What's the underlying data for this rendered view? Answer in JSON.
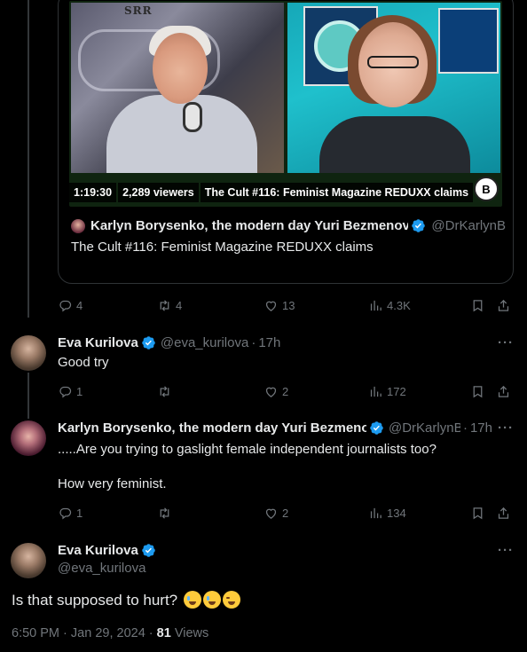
{
  "quote": {
    "video": {
      "duration": "1:19:30",
      "viewers": "2,289 viewers",
      "title": "The Cult #116: Feminist Magazine REDUXX claims",
      "sign_text": "SRR",
      "logo": "B"
    },
    "author_name": "Karlyn Borysenko, the modern day Yuri Bezmenov",
    "author_handle": "@DrKarlynB",
    "text": "The Cult #116: Feminist Magazine REDUXX claims"
  },
  "colors": {
    "background": "#000000",
    "text": "#e7e9ea",
    "muted": "#71767b",
    "verified": "#1d9bf0",
    "border": "#2f3336"
  },
  "first_actions": {
    "replies": "4",
    "reposts": "4",
    "likes": "13",
    "views": "4.3K"
  },
  "reply1": {
    "name": "Eva Kurilova",
    "handle": "@eva_kurilova",
    "time": "17h",
    "text": "Good try",
    "actions": {
      "replies": "1",
      "reposts": "",
      "likes": "2",
      "views": "172"
    }
  },
  "reply2": {
    "name": "Karlyn Borysenko, the modern day Yuri Bezmenov",
    "handle": "@DrKarlynB",
    "time": "17h",
    "text_line1": ".....Are you trying to gaslight female independent journalists too?",
    "text_line2": "How very feminist.",
    "actions": {
      "replies": "1",
      "reposts": "",
      "likes": "2",
      "views": "134"
    }
  },
  "main": {
    "name": "Eva Kurilova",
    "handle": "@eva_kurilova",
    "text": "Is that supposed to hurt?",
    "emojis": [
      "loudly-crying-face",
      "loudly-crying-face",
      "face-with-tears-of-joy"
    ],
    "time": "6:50 PM",
    "date": "Jan 29, 2024",
    "views_count": "81",
    "views_label": "Views"
  },
  "icons": {
    "reply": "reply-icon",
    "repost": "repost-icon",
    "like": "like-icon",
    "views": "views-icon",
    "bookmark": "bookmark-icon",
    "share": "share-icon",
    "more": "more-icon",
    "verified": "verified-badge-icon"
  },
  "separator": "·",
  "more_glyph": "···"
}
